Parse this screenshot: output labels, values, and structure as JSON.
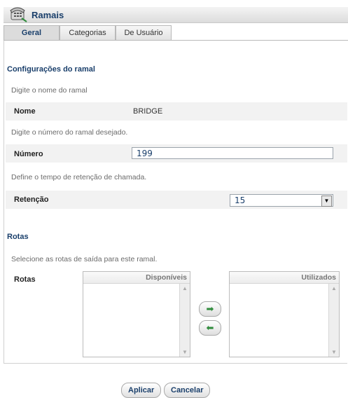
{
  "window": {
    "title": "Ramais",
    "icon": "telephone-icon"
  },
  "tabs": [
    {
      "label": "Geral",
      "active": true
    },
    {
      "label": "Categorias",
      "active": false
    },
    {
      "label": "De Usuário",
      "active": false
    }
  ],
  "config": {
    "section_title": "Configurações do ramal",
    "name_hint": "Digite o nome do ramal",
    "name_label": "Nome",
    "name_value": "BRIDGE",
    "number_hint": "Digite o número do ramal desejado.",
    "number_label": "Número",
    "number_value": "199",
    "hold_hint": "Define o tempo de retenção de chamada.",
    "hold_label": "Retenção",
    "hold_value": "15"
  },
  "routes": {
    "section_title": "Rotas",
    "hint": "Selecione as rotas de saída para este ramal.",
    "label": "Rotas",
    "available_header": "Disponíveis",
    "used_header": "Utilizados",
    "available": [],
    "used": []
  },
  "actions": {
    "apply": "Aplicar",
    "cancel": "Cancelar"
  },
  "colors": {
    "accent": "#1a3f6b",
    "arrow": "#2e8b3a"
  }
}
